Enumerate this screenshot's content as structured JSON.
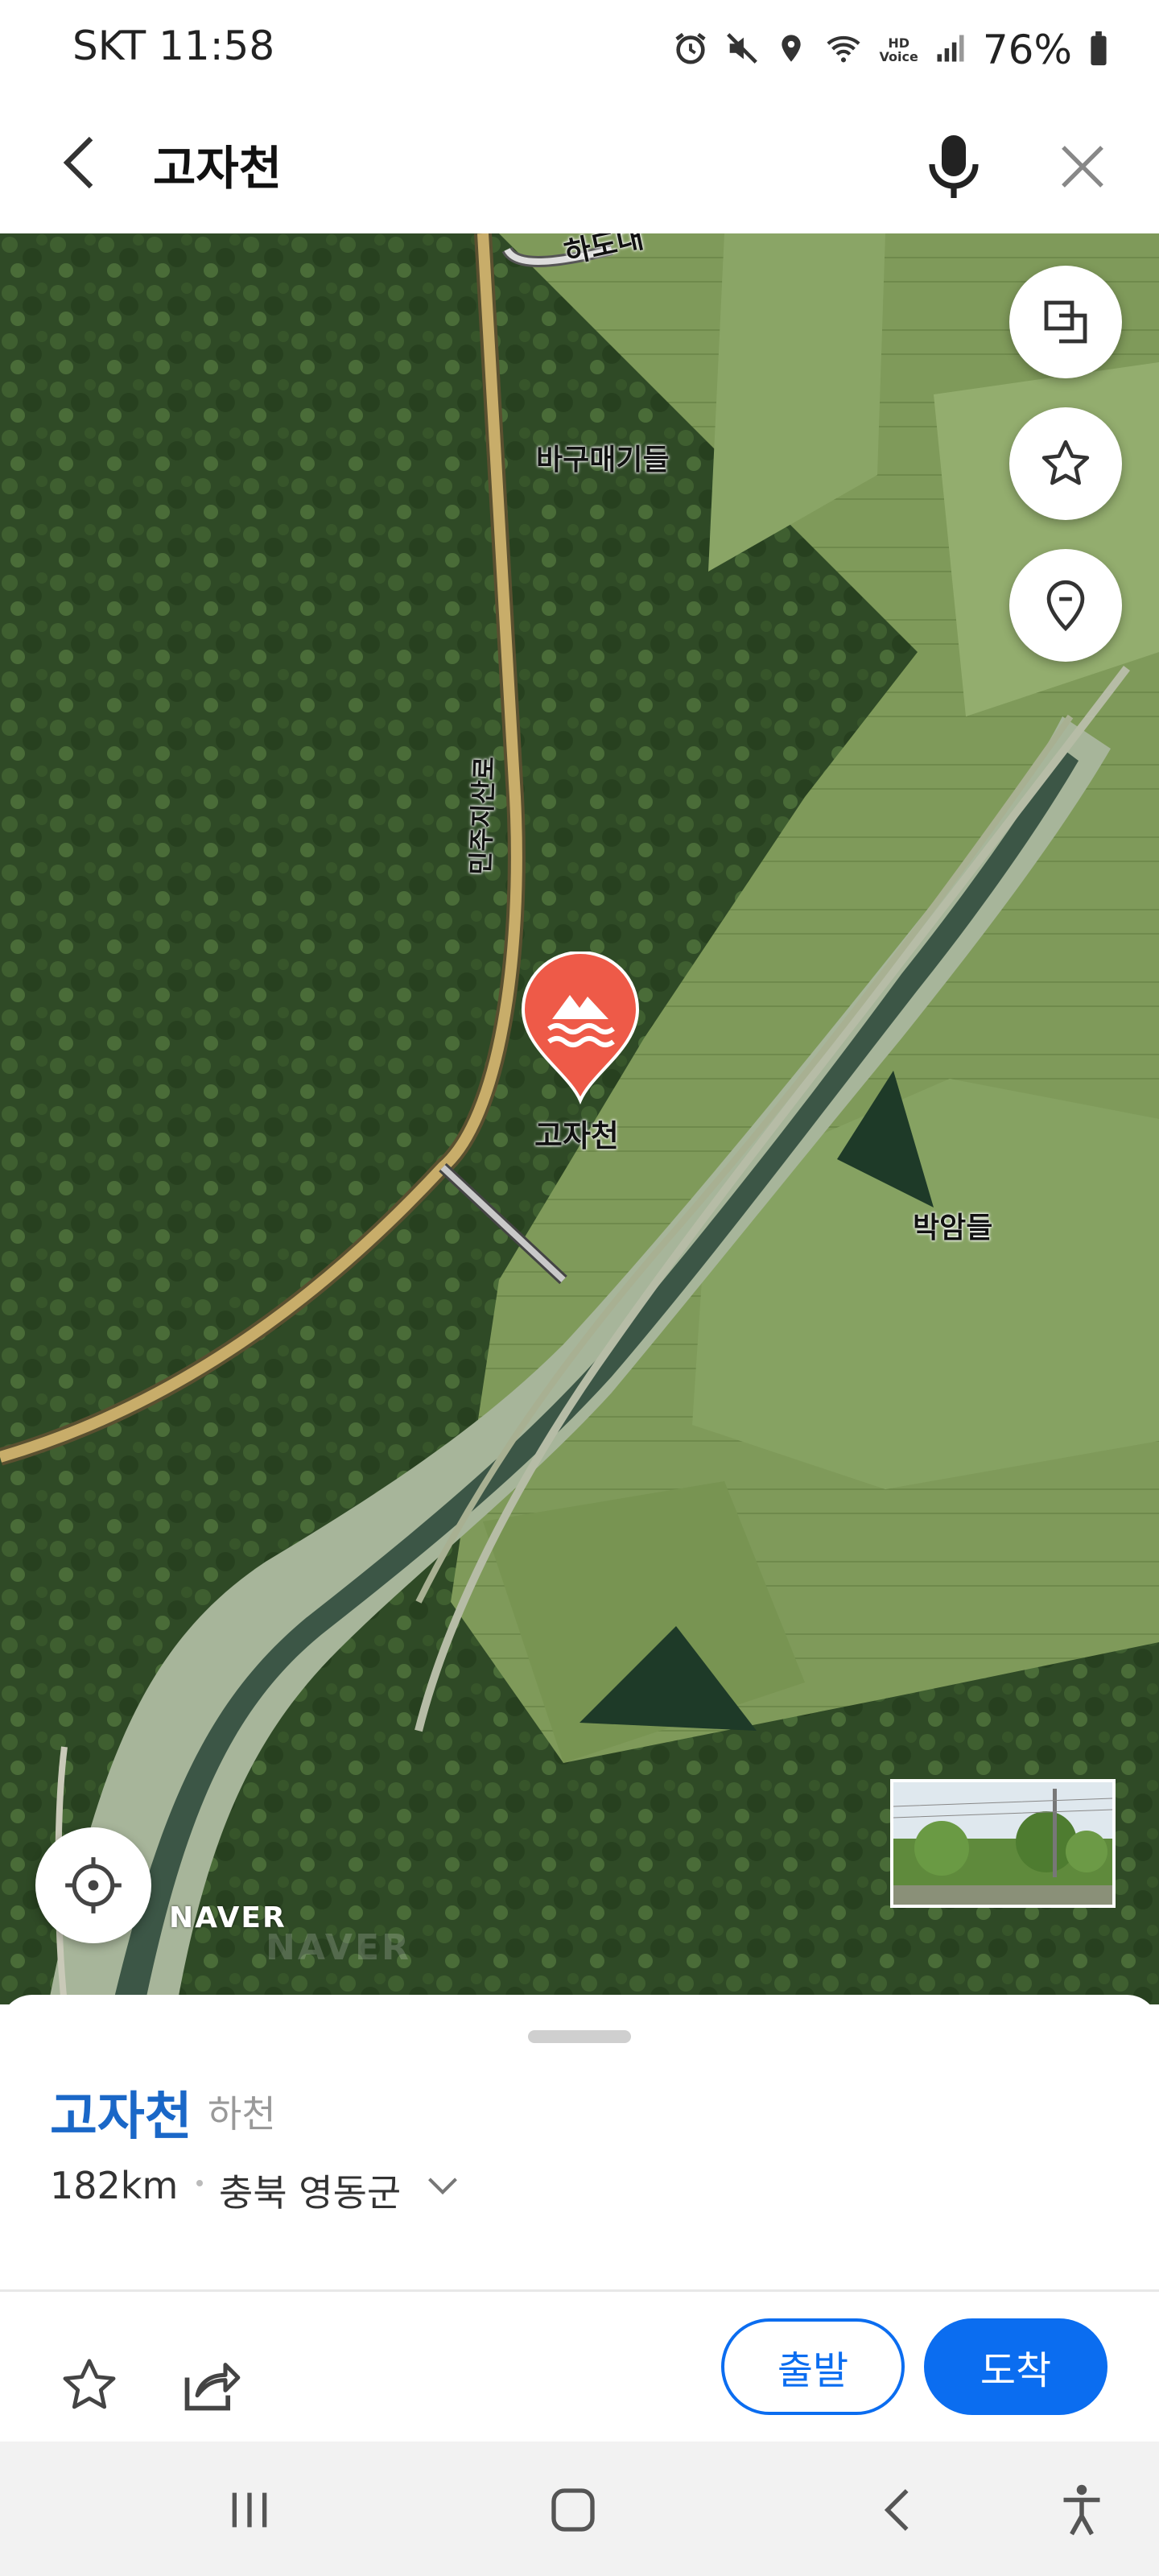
{
  "status_bar": {
    "carrier_time": "SKT 11:58",
    "battery": "76%",
    "hd_voice": "HD\nVoice",
    "icons": [
      "alarm-icon",
      "mute-icon",
      "location-icon",
      "wifi-icon",
      "hd-voice-icon",
      "signal-icon",
      "battery-icon"
    ]
  },
  "header": {
    "query": "고자천",
    "icons": [
      "back-arrow-icon",
      "microphone-icon",
      "close-icon"
    ]
  },
  "map": {
    "labels": {
      "hadoe": "하도대",
      "bagumaegi": "바구매기들",
      "road": "민주지산로",
      "pin_label": "고자천",
      "bakam": "박암들"
    },
    "logo": "NAVER",
    "watermark": "NAVER",
    "marker_color": "#ee5a48",
    "map_buttons": [
      "layers-icon",
      "star-icon",
      "location-pin-icon"
    ],
    "current_location_icon": "crosshair-icon"
  },
  "place": {
    "name": "고자천",
    "category": "하천",
    "distance": "182km",
    "region": "충북 영동군"
  },
  "actions": {
    "depart": "출발",
    "arrive": "도착",
    "accent": "#0b6df0"
  },
  "nav_bar": {
    "icons": [
      "recent-apps-icon",
      "home-icon",
      "back-icon",
      "accessibility-icon"
    ]
  }
}
